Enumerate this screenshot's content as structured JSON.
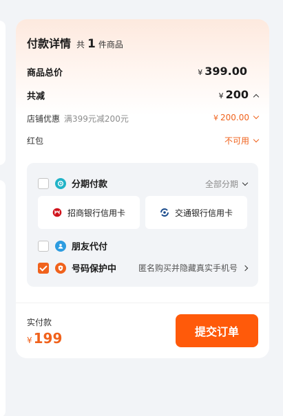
{
  "header": {
    "title": "付款详情",
    "count_prefix": "共",
    "count": "1",
    "count_suffix": "件商品"
  },
  "currency": "¥",
  "summary": {
    "total_label": "商品总价",
    "total_amount": "399.00",
    "discount_label": "共减",
    "discount_amount": "200",
    "shop_label": "店铺优惠",
    "shop_rule": "满399元减200元",
    "shop_amount": "200.00",
    "redpack_label": "红包",
    "redpack_status": "不可用"
  },
  "payment_options": {
    "installment": {
      "label": "分期付款",
      "action": "全部分期",
      "checked": false
    },
    "banks": [
      "招商银行信用卡",
      "交通银行信用卡"
    ],
    "friend_pay": {
      "label": "朋友代付",
      "checked": false
    },
    "number_protect": {
      "label": "号码保护中",
      "desc": "匿名购买并隐藏真实手机号",
      "checked": true
    }
  },
  "footer": {
    "actual_label": "实付款",
    "actual_amount": "199",
    "submit_label": "提交订单"
  },
  "colors": {
    "accent": "#f0621c",
    "button": "#ff5a0a",
    "installment_icon": "#21b3c7",
    "friend_icon": "#2d9ce0",
    "protect_icon": "#f0621c"
  },
  "icons": {
    "installment": "installment-icon",
    "friend": "friend-pay-icon",
    "protect": "number-protect-icon",
    "cmb": "cmb-bank-logo",
    "bocom": "bocom-bank-logo"
  }
}
